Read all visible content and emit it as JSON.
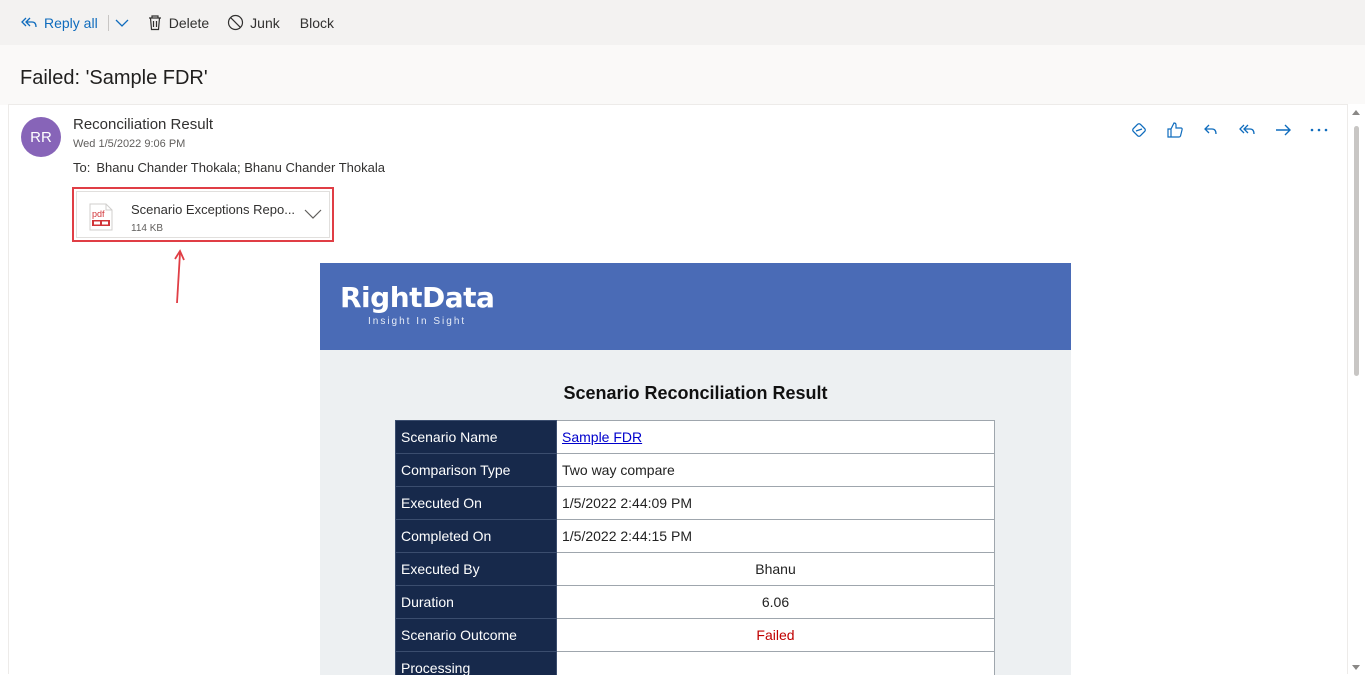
{
  "toolbar": {
    "reply_all": "Reply all",
    "delete": "Delete",
    "junk": "Junk",
    "block": "Block"
  },
  "subject": "Failed: 'Sample FDR'",
  "message": {
    "avatar_initials": "RR",
    "sender": "Reconciliation Result",
    "date": "Wed 1/5/2022 9:06 PM",
    "to_label": "To:",
    "recipients": "Bhanu Chander Thokala; Bhanu Chander Thokala"
  },
  "attachment": {
    "icon": "pdf-file-icon",
    "name": "Scenario Exceptions Repo...",
    "size": "114 KB"
  },
  "body": {
    "logo_text": "RightData",
    "logo_tagline": "Insight In Sight",
    "title": "Scenario Reconciliation Result",
    "rows": [
      {
        "key": "Scenario Name",
        "value": "Sample FDR"
      },
      {
        "key": "Comparison Type",
        "value": "Two way compare"
      },
      {
        "key": "Executed On",
        "value": "1/5/2022 2:44:09 PM"
      },
      {
        "key": "Completed On",
        "value": "1/5/2022 2:44:15 PM"
      },
      {
        "key": "Executed By",
        "value": "Bhanu"
      },
      {
        "key": "Duration",
        "value": "6.06"
      },
      {
        "key": "Scenario Outcome",
        "value": "Failed"
      },
      {
        "key": "Processing",
        "value": ""
      }
    ]
  },
  "colors": {
    "accent": "#0f6cbd",
    "avatar": "#8764b8",
    "banner": "#4a6bb6",
    "table_header": "#17294b",
    "failed": "#c00000",
    "highlight_box": "#e03e45"
  }
}
